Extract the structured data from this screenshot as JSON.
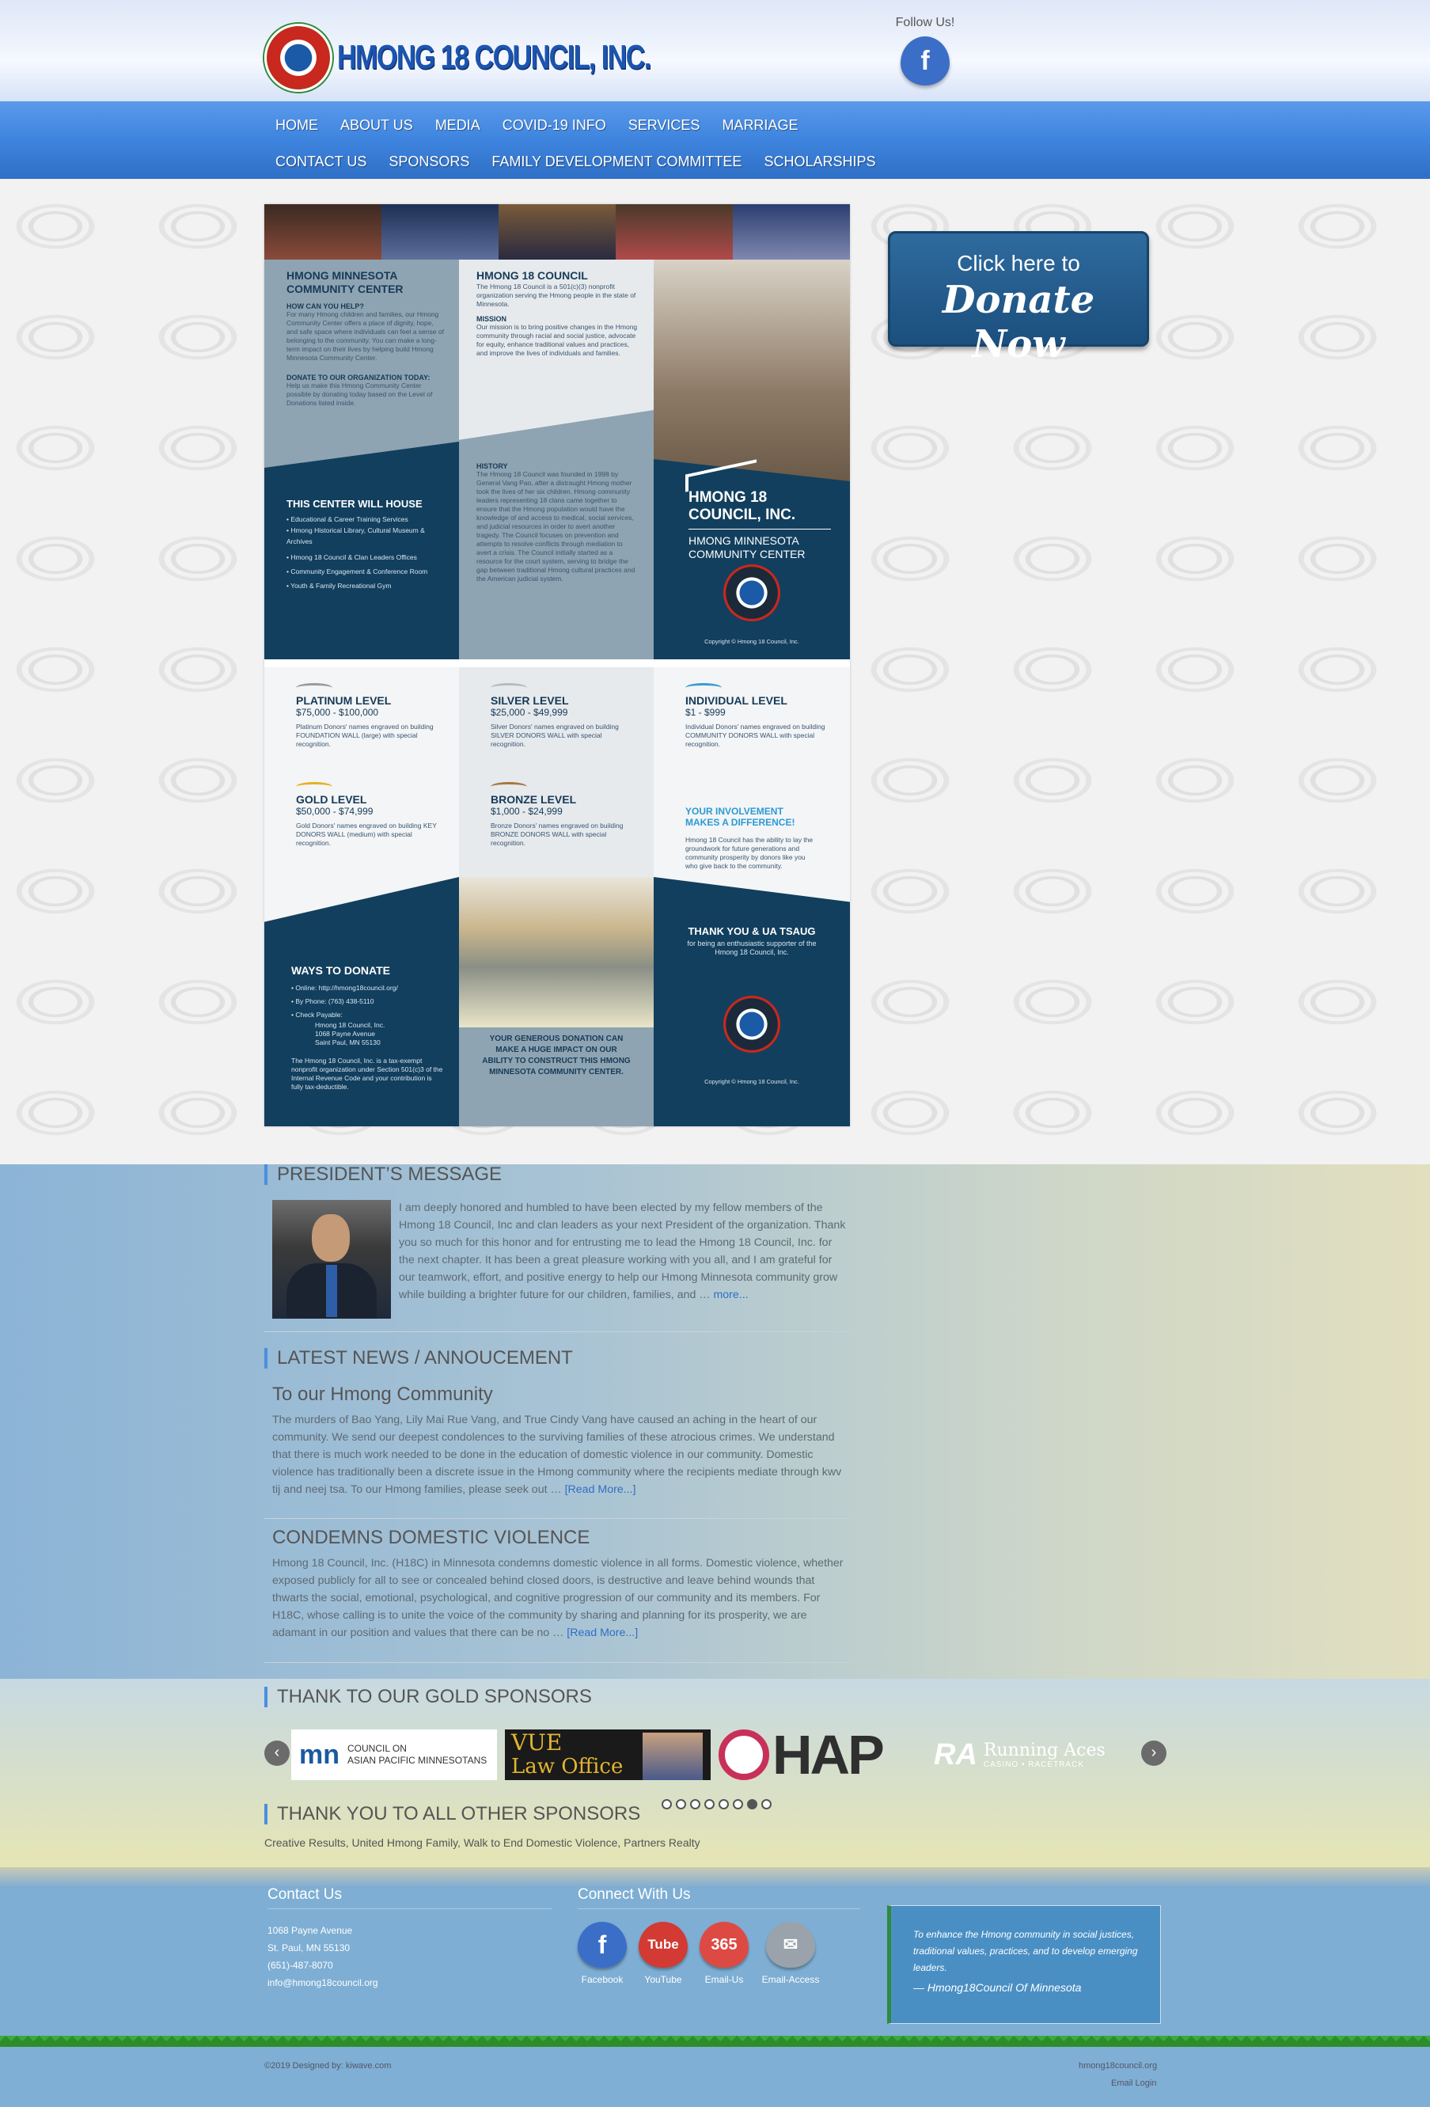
{
  "header": {
    "logo_text": "HMONG 18 COUNCIL, INC.",
    "follow_label": "Follow Us!"
  },
  "nav": {
    "items": [
      "HOME",
      "ABOUT US",
      "MEDIA",
      "COVID-19 INFO",
      "SERVICES",
      "MARRIAGE",
      "CONTACT US",
      "SPONSORS",
      "FAMILY DEVELOPMENT COMMITTEE",
      "SCHOLARSHIPS"
    ]
  },
  "brochure": {
    "left_title": "HMONG MINNESOTA COMMUNITY CENTER",
    "help_head": "HOW CAN YOU HELP?",
    "help_text": "For many Hmong children and families, our Hmong Community Center offers a place of dignity, hope, and safe space where individuals can feel a sense of belonging to the community. You can make a long-term impact on their lives by helping build Hmong Minnesota Community Center.",
    "donate_head": "DONATE TO OUR ORGANIZATION TODAY:",
    "donate_text": "Help us make this Hmong Community Center possible by donating today based on the Level of Donations listed inside.",
    "center_title": "HMONG 18 COUNCIL",
    "center_intro": "The Hmong 18 Council is a 501(c)(3) nonprofit organization serving the Hmong people in the state of Minnesota.",
    "mission_head": "MISSION",
    "mission_text": "Our mission is to bring positive changes in the Hmong community through racial and social justice, advocate for equity, enhance traditional values and practices, and improve the lives of individuals and families.",
    "house_title": "THIS CENTER WILL HOUSE",
    "house_items": [
      "• Educational & Career Training Services",
      "• Hmong Historical Library, Cultural Museum & Archives",
      "• Hmong 18 Council & Clan Leaders Offices",
      "• Community Engagement & Conference Room",
      "• Youth & Family Recreational Gym"
    ],
    "history_head": "HISTORY",
    "history_text": "The Hmong 18 Council was founded in 1998 by General Vang Pao, after a distraught Hmong mother took the lives of her six children. Hmong community leaders representing 18 clans came together to ensure that the Hmong population would have the knowledge of and access to medical, social services, and judicial resources in order to avert another tragedy. The Council focuses on prevention and attempts to resolve conflicts through mediation to avert a crisis. The Council initially started as a resource for the court system, serving to bridge the gap between traditional Hmong cultural practices and the American judicial system.",
    "right_title": "HMONG 18 COUNCIL, INC.",
    "right_sub": "HMONG MINNESOTA COMMUNITY CENTER",
    "copyright": "Copyright © Hmong 18 Council, Inc.",
    "levels": [
      {
        "title": "PLATINUM LEVEL",
        "range": "$75,000 - $100,000",
        "text": "Platinum Donors' names engraved on building FOUNDATION WALL (large) with special recognition.",
        "color": "#9a9a9a"
      },
      {
        "title": "SILVER LEVEL",
        "range": "$25,000 - $49,999",
        "text": "Silver Donors' names engraved on building SILVER DONORS WALL with special recognition.",
        "color": "#b9b9b9"
      },
      {
        "title": "INDIVIDUAL LEVEL",
        "range": "$1 - $999",
        "text": "Individual Donors' names engraved on building COMMUNITY DONORS WALL with special recognition.",
        "color": "#3a9bd0"
      },
      {
        "title": "GOLD LEVEL",
        "range": "$50,000 - $74,999",
        "text": "Gold Donors' names engraved on building KEY DONORS WALL (medium) with special recognition.",
        "color": "#e3b31d"
      },
      {
        "title": "BRONZE LEVEL",
        "range": "$1,000 - $24,999",
        "text": "Bronze Donors' names engraved on building BRONZE DONORS WALL with special recognition.",
        "color": "#a8763e"
      }
    ],
    "involve_title": "YOUR INVOLVEMENT MAKES A DIFFERENCE!",
    "involve_text": "Hmong 18 Council has the ability to lay the groundwork for future generations and community prosperity by donors like you who give back to the community.",
    "ways_title": "WAYS TO DONATE",
    "ways_items": [
      "• Online: http://hmong18council.org/",
      "• By Phone: (763) 438-5110",
      "• Check Payable:",
      "Hmong 18 Council, Inc.",
      "1068 Payne Avenue",
      "Saint Paul, MN 55130"
    ],
    "ways_note": "The Hmong 18 Council, Inc. is a tax-exempt nonprofit organization under Section 501(c)3 of the Internal Revenue Code and your contribution is fully tax-deductible.",
    "impact_text": "YOUR GENEROUS DONATION CAN MAKE A HUGE IMPACT ON OUR ABILITY TO CONSTRUCT THIS HMONG MINNESOTA COMMUNITY CENTER.",
    "thanks_title": "THANK YOU & UA TSAUG",
    "thanks_text": "for being an enthusiastic supporter of the Hmong 18 Council, Inc."
  },
  "donate_button": {
    "line1": "Click here to",
    "line2": "Donate Now"
  },
  "president": {
    "heading": "PRESIDENT’S MESSAGE",
    "text": "I am deeply honored and humbled to have been elected by my fellow members of the Hmong 18 Council, Inc and clan leaders as your next President of the organization. Thank you so much for this honor and for entrusting me to lead the Hmong 18 Council, Inc. for the next chapter. It has been a great pleasure working with you all, and I am grateful for our teamwork, effort, and positive energy to help our Hmong Minnesota community grow while building a brighter future for our children, families, and … ",
    "more": "more..."
  },
  "news": {
    "heading": "LATEST NEWS / ANNOUCEMENT",
    "items": [
      {
        "title": "To our Hmong Community",
        "text": "The murders of Bao Yang, Lily Mai Rue Vang, and True Cindy Vang have caused an aching in the heart of our community. We send our deepest condolences to the surviving families of these atrocious crimes. We understand that there is much work needed to be done in the education of domestic violence in our community. Domestic violence has traditionally been a discrete issue in the Hmong community where the recipients mediate through kwv tij and neej tsa. To our Hmong families, please seek out … ",
        "more": "[Read More...]"
      },
      {
        "title": "CONDEMNS DOMESTIC VIOLENCE",
        "text": "Hmong 18 Council, Inc. (H18C) in Minnesota condemns domestic violence in all forms. Domestic violence, whether exposed publicly for all to see or concealed behind closed doors, is destructive and leave behind wounds that thwarts the social, emotional, psychological, and cognitive progression of our community and its members. For H18C, whose calling is to unite the voice of the community by sharing and planning for its prosperity, we are adamant in our position and values that there can be no … ",
        "more": "[Read More...]"
      }
    ]
  },
  "sponsors": {
    "gold_heading": "THANK TO OUR GOLD SPONSORS",
    "logos": {
      "capm_line1": "COUNCIL ON",
      "capm_line2": "ASIAN PACIFIC MINNESOTANS",
      "capm_mark": "mn",
      "vue_line1": "VUE",
      "vue_line2": "Law Office",
      "hap": "HAP",
      "ra_mark": "RA",
      "ra_name": "Running Aces",
      "ra_sub": "CASINO • RACETRACK"
    },
    "prev_arrow": "‹",
    "next_arrow": "›",
    "dot_count": 8,
    "active_dot": 6,
    "other_heading": "THANK YOU TO ALL OTHER SPONSORS",
    "other_list": "Creative Results, United Hmong Family, Walk to End Domestic Violence, Partners Realty"
  },
  "footer": {
    "contact_heading": "Contact Us",
    "address1": "1068 Payne Avenue",
    "address2": "St. Paul, MN 55130",
    "phone": "(651)-487-8070",
    "email": "info@hmong18council.org",
    "connect_heading": "Connect With Us",
    "social": [
      {
        "label": "Facebook",
        "glyph": "f",
        "color": "#3b6ec7"
      },
      {
        "label": "YouTube",
        "glyph": "Tube",
        "color": "#d23a33"
      },
      {
        "label": "Email-Us",
        "glyph": "365",
        "color": "#dd4a44"
      },
      {
        "label": "Email-Access",
        "glyph": "✉",
        "color": "#9aa3ab"
      }
    ],
    "quote": "To enhance the Hmong community in social justices, traditional values, practices, and to develop emerging leaders.",
    "quote_author": "— Hmong18Council Of Minnesota"
  },
  "bottom": {
    "designed": "©2019 Designed by: kiwave.com",
    "site": "hmong18council.org",
    "email_login": "Email Login"
  },
  "colors": {
    "nav_blue": "#3e84de",
    "brochure_navy": "#123f5e",
    "link_blue": "#2f6fc6",
    "footer_blue": "#7eaed3",
    "grass_green": "#3cab3a"
  }
}
